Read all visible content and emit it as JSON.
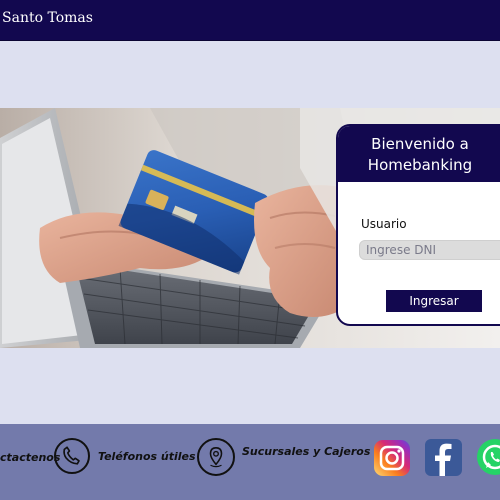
{
  "header": {
    "brand": "Santo Tomas",
    "background": "#12084f"
  },
  "login": {
    "title_line1": "Bienvenido a",
    "title_line2": "Homebanking",
    "user_label": "Usuario",
    "user_placeholder": "Ingrese DNI",
    "submit_label": "Ingresar"
  },
  "footer": {
    "background": "#737aab",
    "items": [
      {
        "label": "ctactenos",
        "icon": "contact-icon"
      },
      {
        "label": "Teléfonos útiles",
        "icon": "phone-icon"
      },
      {
        "label": "Sucursales y Cajeros",
        "icon": "location-pin-icon"
      }
    ],
    "social": [
      {
        "name": "instagram-icon"
      },
      {
        "name": "facebook-icon"
      },
      {
        "name": "whatsapp-icon"
      }
    ]
  },
  "hero": {
    "image": "hands-with-credit-card-and-laptop"
  }
}
